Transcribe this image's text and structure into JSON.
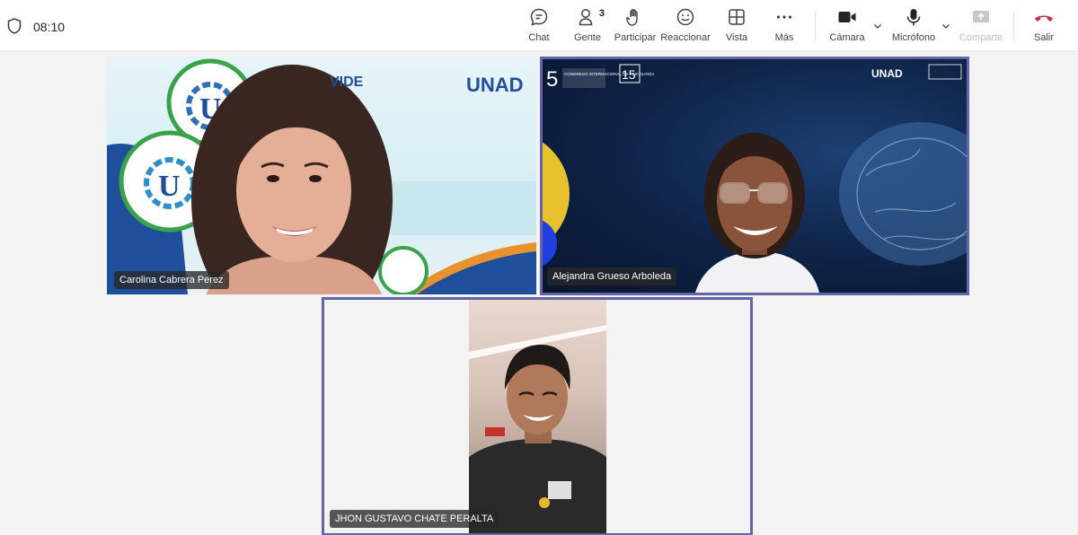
{
  "meeting": {
    "timer": "08:10"
  },
  "toolbar": {
    "chat": {
      "label": "Chat"
    },
    "people": {
      "label": "Gente",
      "count": "3"
    },
    "raise_hand": {
      "label": "Participar"
    },
    "react": {
      "label": "Reaccionar"
    },
    "view": {
      "label": "Vista"
    },
    "more": {
      "label": "Más"
    },
    "camera": {
      "label": "Cámara"
    },
    "mic": {
      "label": "Micrófono"
    },
    "share": {
      "label": "Comparte"
    },
    "leave": {
      "label": "Salir"
    }
  },
  "participants": [
    {
      "name": "Carolina Cabrera Perez"
    },
    {
      "name": "Alejandra Grueso Arboleda"
    },
    {
      "name": "JHON GUSTAVO CHATE PERALTA"
    }
  ],
  "slides": {
    "tile1_brand": "UNAD",
    "tile1_brand_left": "VIDE",
    "tile2_congress_num": "5",
    "tile2_congress_text": "CONGRESO INTERNACIONAL DE PSICOLOGÍA",
    "tile2_symposium_num": "15",
    "tile2_brand": "UNAD"
  },
  "colors": {
    "accent": "#6264a7",
    "leave": "#c4314b"
  }
}
